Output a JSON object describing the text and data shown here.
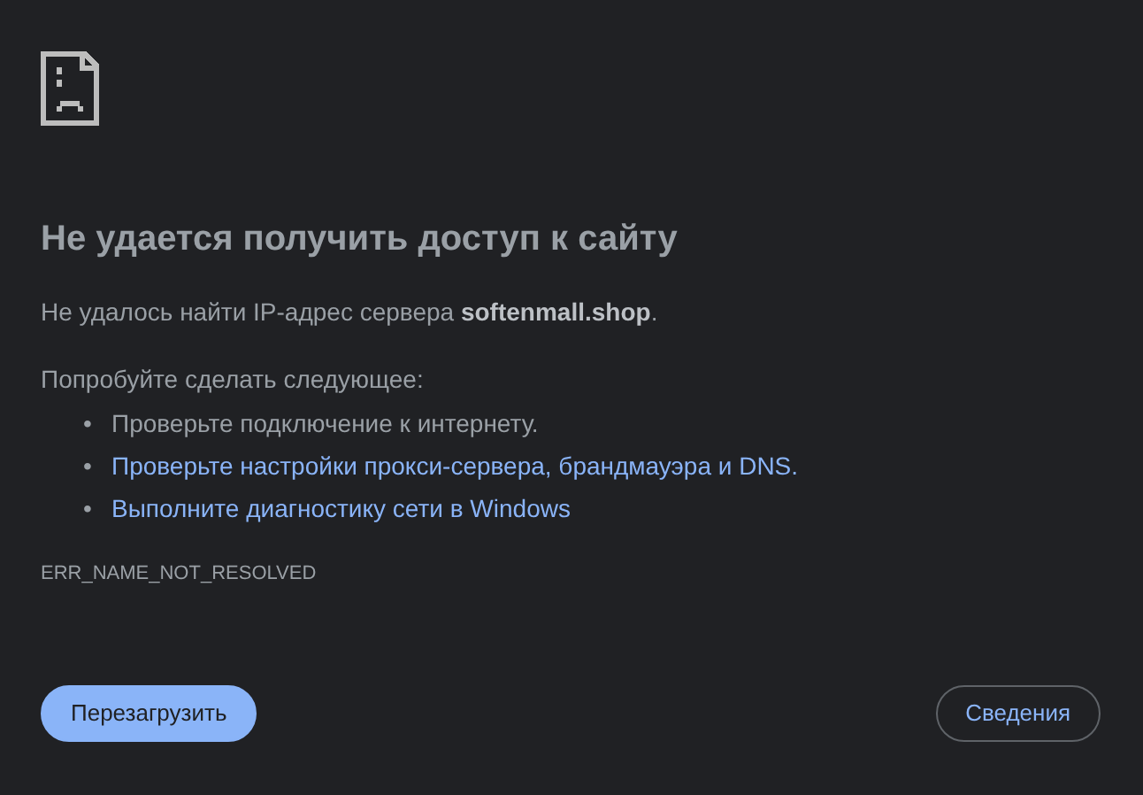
{
  "heading": "Не удается получить доступ к сайту",
  "summary": "Не удалось найти IP-адрес сервера **softenmall.shop**.",
  "suggestions_title": "Попробуйте сделать следующее:",
  "suggestions": [
    {
      "kind": "text",
      "bullet": "•",
      "text": "Проверьте подключение к интернету."
    },
    {
      "kind": "link",
      "bullet": "•",
      "text": "Проверьте настройки прокси-сервера, брандмауэра и DNS."
    },
    {
      "kind": "link",
      "bullet": "•",
      "text": "Выполните диагностику сети в Windows"
    }
  ],
  "error_code": "ERR_NAME_NOT_RESOLVED",
  "buttons": [
    {
      "kind": "primary",
      "label": "Перезагрузить"
    },
    {
      "kind": "outline",
      "label": "Сведения"
    }
  ]
}
